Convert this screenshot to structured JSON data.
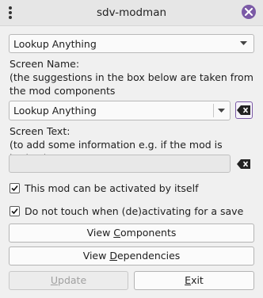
{
  "window": {
    "title": "sdv-modman"
  },
  "icons": {
    "menu": "kebab-menu-icon",
    "close": "close-icon",
    "dropdown": "chevron-down-icon",
    "clear": "backspace-clear-icon",
    "check": "check-icon"
  },
  "colors": {
    "accent": "#7b5aa6"
  },
  "top_select": {
    "value": "Lookup Anything"
  },
  "screen_name": {
    "label_line1": "Screen Name:",
    "label_line2": "(the suggestions in the box below are taken from",
    "label_line3": "the mod components",
    "value": "Lookup Anything"
  },
  "screen_text": {
    "label_line1": "Screen Text:",
    "label_line2": "(to add some information e.g. if the mod is broken)",
    "value": ""
  },
  "options": {
    "standalone": {
      "label": "This mod can be activated by itself",
      "checked": true
    },
    "save_lock": {
      "label": "Do not touch when (de)activating for a save",
      "checked": true
    }
  },
  "buttons": {
    "components_pre": "View ",
    "components_key": "C",
    "components_post": "omponents",
    "dependencies_pre": "View ",
    "dependencies_key": "D",
    "dependencies_post": "ependencies",
    "update_key": "U",
    "update_post": "pdate",
    "exit_key": "E",
    "exit_post": "xit"
  }
}
